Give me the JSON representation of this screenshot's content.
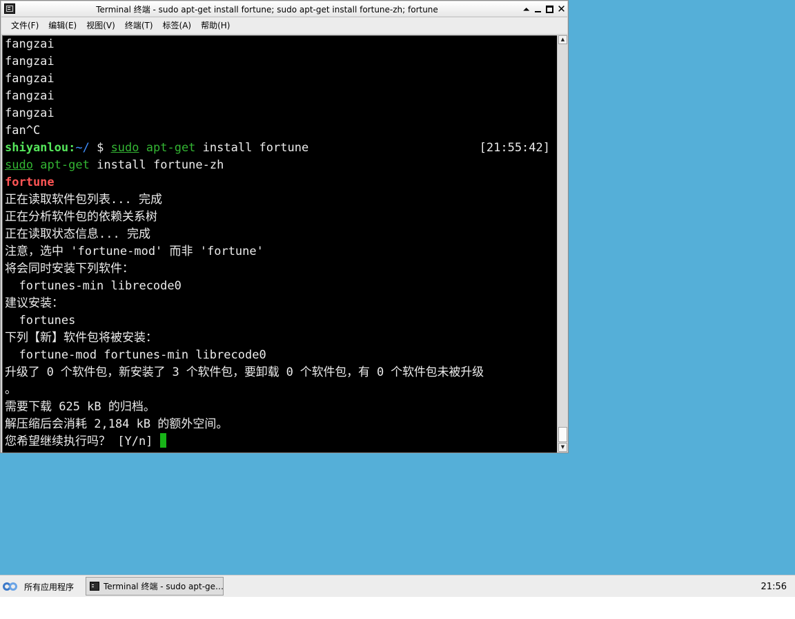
{
  "window": {
    "title": "Terminal 终端 - sudo apt-get install fortune; sudo apt-get install fortune-zh; fortune",
    "buttons": {
      "shade": "⏶",
      "close": "✕"
    }
  },
  "menu": [
    {
      "label": "文件(F)"
    },
    {
      "label": "编辑(E)"
    },
    {
      "label": "视图(V)"
    },
    {
      "label": "终端(T)"
    },
    {
      "label": "标签(A)"
    },
    {
      "label": "帮助(H)"
    }
  ],
  "terminal": {
    "lines": [
      "fangzai",
      "fangzai",
      "fangzai",
      "fangzai",
      "fangzai",
      "fan^C"
    ],
    "prompt": {
      "user": "shiyanlou:",
      "path": "~/",
      "symbol": " $ ",
      "sudo": "sudo",
      "aptget": "apt-get",
      "rest": " install fortune",
      "time": "[21:55:42]"
    },
    "cont1": {
      "sudo": "sudo",
      "aptget": "apt-get",
      "rest": " install fortune-zh"
    },
    "cont2": "fortune",
    "output": [
      "正在读取软件包列表... 完成",
      "正在分析软件包的依赖关系树",
      "正在读取状态信息... 完成",
      "注意，选中 'fortune-mod' 而非 'fortune'",
      "将会同时安装下列软件：",
      "  fortunes-min librecode0",
      "建议安装：",
      "  fortunes",
      "下列【新】软件包将被安装：",
      "  fortune-mod fortunes-min librecode0",
      "升级了 0 个软件包，新安装了 3 个软件包，要卸载 0 个软件包，有 0 个软件包未被升级",
      "。",
      "需要下载 625 kB 的归档。",
      "解压缩后会消耗 2,184 kB 的额外空间。",
      "您希望继续执行吗？ [Y/n] "
    ]
  },
  "taskbar": {
    "start_label": "所有应用程序",
    "task_label": "Terminal 终端 - sudo apt-ge…",
    "clock": "21:56"
  }
}
